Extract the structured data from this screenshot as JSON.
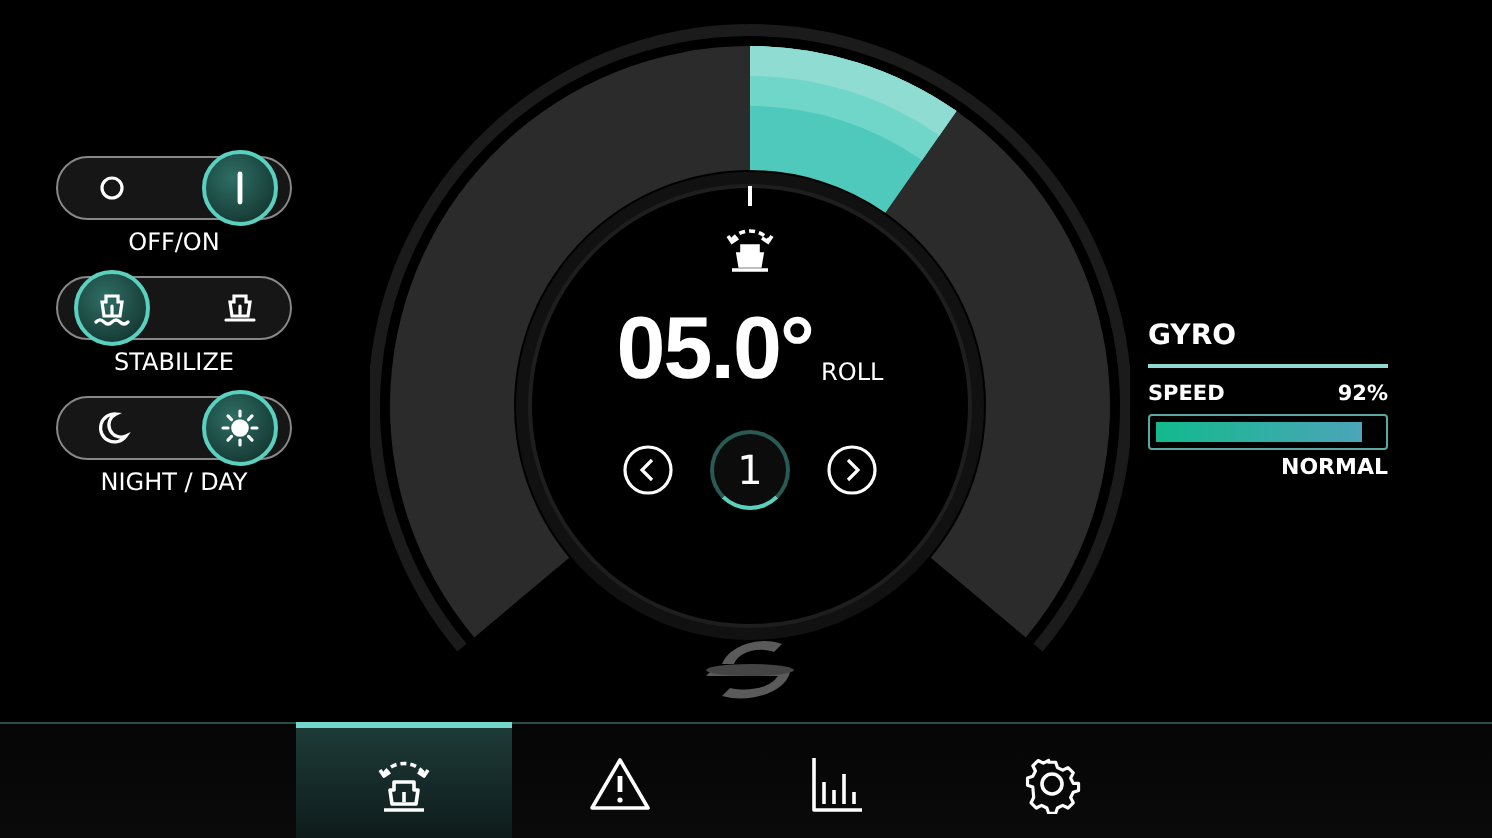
{
  "toggles": [
    {
      "label": "OFF/ON",
      "options": [
        {
          "kind": "off",
          "selected": false
        },
        {
          "kind": "on",
          "selected": true
        }
      ]
    },
    {
      "label": "STABILIZE",
      "options": [
        {
          "kind": "boat-waves",
          "selected": true
        },
        {
          "kind": "boat",
          "selected": false
        }
      ]
    },
    {
      "label": "NIGHT / DAY",
      "options": [
        {
          "kind": "moon",
          "selected": false
        },
        {
          "kind": "sun",
          "selected": true
        }
      ]
    }
  ],
  "gauge": {
    "value": "05.0°",
    "unit": "ROLL",
    "page": "1"
  },
  "gyro": {
    "title": "GYRO",
    "speed_label": "SPEED",
    "speed_value": "92%",
    "level": 0.92,
    "mode": "NORMAL"
  },
  "nav": [
    {
      "kind": "roll",
      "selected": true
    },
    {
      "kind": "warning",
      "selected": false
    },
    {
      "kind": "chart",
      "selected": false
    },
    {
      "kind": "settings",
      "selected": false
    }
  ]
}
